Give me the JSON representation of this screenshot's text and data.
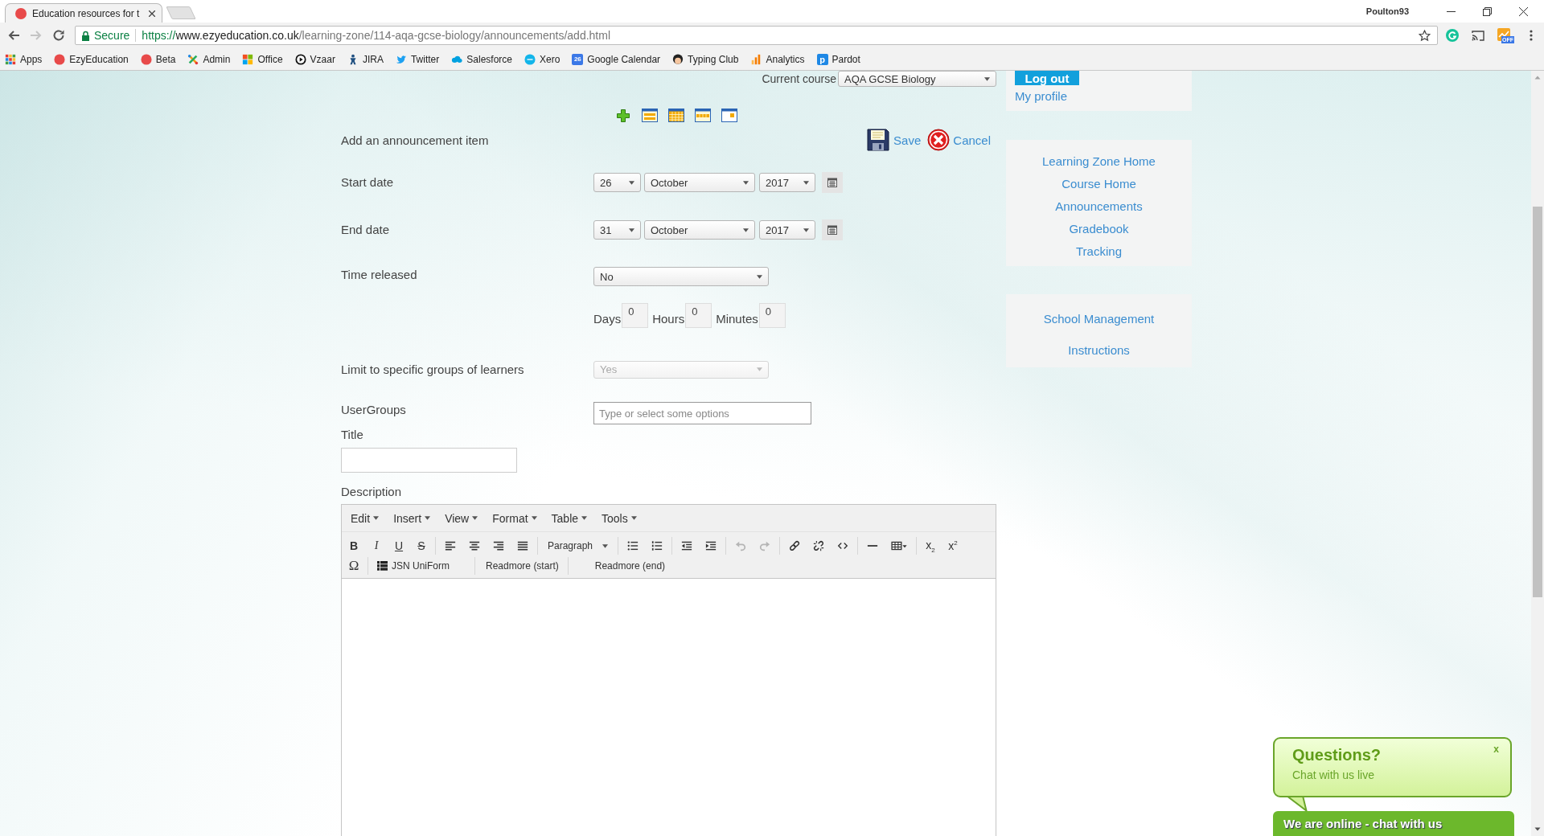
{
  "browser": {
    "tabs": [
      {
        "title": "Education resources for t",
        "selected": true
      }
    ],
    "user": "Poulton93",
    "forward_disabled": true,
    "address": {
      "security": "Secure",
      "scheme": "https://",
      "host": "www.ezyeducation.co.uk",
      "path": "/learning-zone/114-aqa-gcse-biology/announcements/add.html"
    },
    "extension_badge": "OFF",
    "bookmarks": [
      {
        "label": "Apps"
      },
      {
        "label": "EzyEducation"
      },
      {
        "label": "Beta"
      },
      {
        "label": "Admin"
      },
      {
        "label": "Office"
      },
      {
        "label": "Vzaar"
      },
      {
        "label": "JIRA"
      },
      {
        "label": "Twitter"
      },
      {
        "label": "Salesforce"
      },
      {
        "label": "Xero"
      },
      {
        "label": "Google Calendar",
        "icon_text": "26"
      },
      {
        "label": "Typing Club"
      },
      {
        "label": "Analytics"
      },
      {
        "label": "Pardot",
        "icon_text": "p"
      }
    ]
  },
  "course_bar": {
    "label": "Current course",
    "value": "AQA GCSE Biology"
  },
  "form": {
    "heading": "Add an announcement item",
    "actions": [
      {
        "label": "Save"
      },
      {
        "label": "Cancel"
      }
    ],
    "dates": [
      {
        "label": "Start date",
        "day": "26",
        "month": "October",
        "year": "2017"
      },
      {
        "label": "End date",
        "day": "31",
        "month": "October",
        "year": "2017"
      }
    ],
    "time_released": {
      "label": "Time released",
      "value": "No"
    },
    "offsets": [
      {
        "label": "Days",
        "value": "0"
      },
      {
        "label": "Hours",
        "value": "0"
      },
      {
        "label": "Minutes",
        "value": "0"
      }
    ],
    "limit_groups": {
      "label": "Limit to specific groups of learners",
      "value": "Yes",
      "disabled": true
    },
    "user_groups": {
      "label": "UserGroups",
      "placeholder": "Type or select some options"
    },
    "title": {
      "label": "Title"
    },
    "description": {
      "label": "Description"
    }
  },
  "editor": {
    "menus": [
      "Edit",
      "Insert",
      "View",
      "Format",
      "Table",
      "Tools"
    ],
    "format_buttons": [
      "B",
      "I",
      "U",
      "S"
    ],
    "block_format": "Paragraph",
    "history": [
      {
        "disabled": true
      },
      {
        "disabled": true
      }
    ],
    "script_buttons": [
      "x$_{2}$",
      "x$^{2}$"
    ],
    "special_char": "Ω",
    "plugins": [
      "JSN UniForm",
      "Readmore (start)",
      "Readmore (end)"
    ]
  },
  "sidebar": {
    "logout": "Log out",
    "profile": "My profile",
    "course_links": [
      "Learning Zone Home",
      "Course Home",
      "Announcements",
      "Gradebook",
      "Tracking"
    ],
    "school_links": [
      "School Management",
      "Instructions"
    ]
  },
  "chat": {
    "title": "Questions?",
    "subtitle": "Chat with us live",
    "close": "x",
    "bar": "We are online - chat with us"
  }
}
